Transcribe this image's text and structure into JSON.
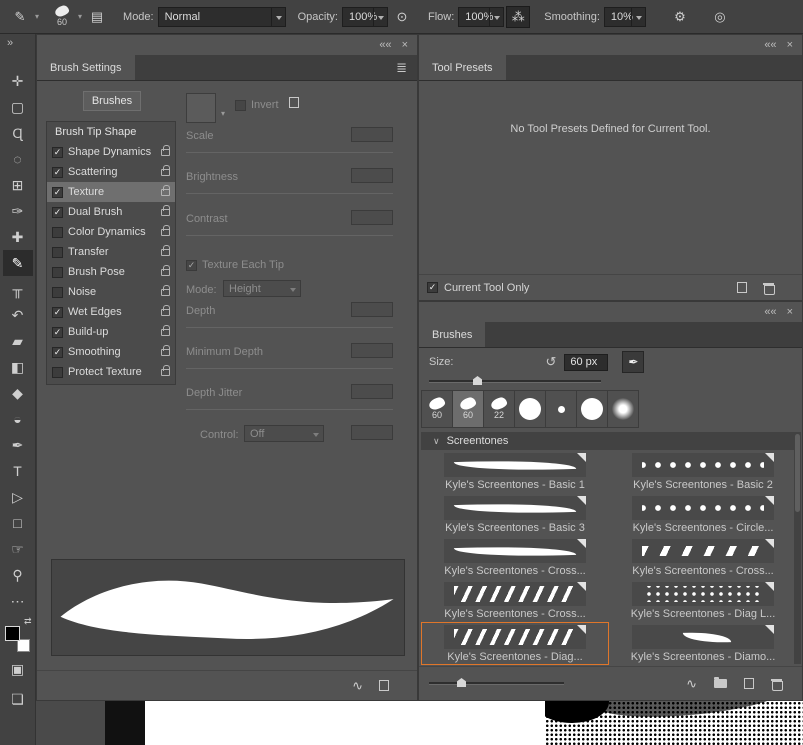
{
  "icons": {
    "expand": "»",
    "collapse": "««",
    "close": "×",
    "menu": "≣",
    "chevron_down": "∨",
    "swap": "⇄",
    "gear": "⚙",
    "airbrush": "⁂",
    "pressure_opacity": "⊙",
    "pressure_size": "◎",
    "reset": "↺",
    "wave": "∿",
    "brush_tip": "✒",
    "panel_toggle": "▤",
    "brush_tool_small": "✎",
    "dropdown_caret": "▾",
    "texture_picker": "❏"
  },
  "options_bar": {
    "brush_preview_size": "60",
    "mode_label": "Mode:",
    "mode_value": "Normal",
    "opacity_label": "Opacity:",
    "opacity_value": "100%",
    "flow_label": "Flow:",
    "flow_value": "100%",
    "smoothing_label": "Smoothing:",
    "smoothing_value": "10%"
  },
  "toolbar": {
    "quick_mask_glyph": "▣",
    "screen_mode_glyph": "❏",
    "tools": [
      {
        "name": "move-tool",
        "glyph": "✛"
      },
      {
        "name": "marquee-tool",
        "glyph": "▢"
      },
      {
        "name": "lasso-tool",
        "glyph": "Ɋ"
      },
      {
        "name": "quick-selection-tool",
        "glyph": "◌"
      },
      {
        "name": "crop-tool",
        "glyph": "⊞"
      },
      {
        "name": "eyedropper-tool",
        "glyph": "✑"
      },
      {
        "name": "healing-brush-tool",
        "glyph": "✚"
      },
      {
        "name": "brush-tool",
        "glyph": "✎",
        "selected": true
      },
      {
        "name": "clone-stamp-tool",
        "glyph": "╥"
      },
      {
        "name": "history-brush-tool",
        "glyph": "↶"
      },
      {
        "name": "eraser-tool",
        "glyph": "▰"
      },
      {
        "name": "gradient-tool",
        "glyph": "◧"
      },
      {
        "name": "blur-tool",
        "glyph": "◆"
      },
      {
        "name": "dodge-tool",
        "glyph": "◒"
      },
      {
        "name": "pen-tool",
        "glyph": "✒"
      },
      {
        "name": "type-tool",
        "glyph": "T"
      },
      {
        "name": "path-selection-tool",
        "glyph": "▷"
      },
      {
        "name": "rectangle-tool",
        "glyph": "□"
      },
      {
        "name": "hand-tool",
        "glyph": "☞"
      },
      {
        "name": "zoom-tool",
        "glyph": "⚲"
      },
      {
        "name": "edit-toolbar",
        "glyph": "⋯"
      }
    ]
  },
  "brush_settings": {
    "tab_label": "Brush Settings",
    "brushes_button_label": "Brushes",
    "list_header": "Brush Tip Shape",
    "options": [
      {
        "label": "Shape Dynamics",
        "checked": true
      },
      {
        "label": "Scattering",
        "checked": true
      },
      {
        "label": "Texture",
        "checked": true,
        "selected": true
      },
      {
        "label": "Dual Brush",
        "checked": true
      },
      {
        "label": "Color Dynamics",
        "checked": false
      },
      {
        "label": "Transfer",
        "checked": false
      },
      {
        "label": "Brush Pose",
        "checked": false
      },
      {
        "label": "Noise",
        "checked": false
      },
      {
        "label": "Wet Edges",
        "checked": true
      },
      {
        "label": "Build-up",
        "checked": true
      },
      {
        "label": "Smoothing",
        "checked": true
      },
      {
        "label": "Protect Texture",
        "checked": false
      }
    ],
    "texture": {
      "invert_label": "Invert",
      "scale_label": "Scale",
      "brightness_label": "Brightness",
      "contrast_label": "Contrast",
      "each_tip_label": "Texture Each Tip",
      "mode_label": "Mode:",
      "mode_value": "Height",
      "depth_label": "Depth",
      "minimum_depth_label": "Minimum Depth",
      "depth_jitter_label": "Depth Jitter",
      "control_label": "Control:",
      "control_value": "Off"
    }
  },
  "tool_presets": {
    "tab_label": "Tool Presets",
    "empty_message": "No Tool Presets Defined for Current Tool.",
    "current_tool_only_label": "Current Tool Only"
  },
  "brushes_panel": {
    "tab_label": "Brushes",
    "size_label": "Size:",
    "size_value": "60 px",
    "group_label": "Screentones",
    "tip_thumbnails": [
      {
        "label": "60",
        "type": "splat"
      },
      {
        "label": "60",
        "type": "splat",
        "selected": true
      },
      {
        "label": "22",
        "type": "splat"
      },
      {
        "type": "circle"
      },
      {
        "type": "dot"
      },
      {
        "type": "circle"
      },
      {
        "type": "soft"
      }
    ],
    "presets": [
      {
        "label": "Kyle's Screentones - Basic 1",
        "pattern": "taper"
      },
      {
        "label": "Kyle's Screentones - Basic 2",
        "pattern": "dots"
      },
      {
        "label": "Kyle's Screentones - Basic 3",
        "pattern": "taper"
      },
      {
        "label": "Kyle's Screentones - Circle...",
        "pattern": "dots"
      },
      {
        "label": "Kyle's Screentones - Cross...",
        "pattern": "taper"
      },
      {
        "label": "Kyle's Screentones - Cross...",
        "pattern": "dash"
      },
      {
        "label": "Kyle's Screentones - Cross...",
        "pattern": "hatch"
      },
      {
        "label": "Kyle's Screentones - Diag L...",
        "pattern": "dots-small"
      },
      {
        "label": "Kyle's Screentones - Diag...",
        "pattern": "hatch",
        "selected": true
      },
      {
        "label": "Kyle's Screentones - Diamo...",
        "pattern": "taper-small"
      }
    ],
    "selection_color": "#e0762a"
  }
}
